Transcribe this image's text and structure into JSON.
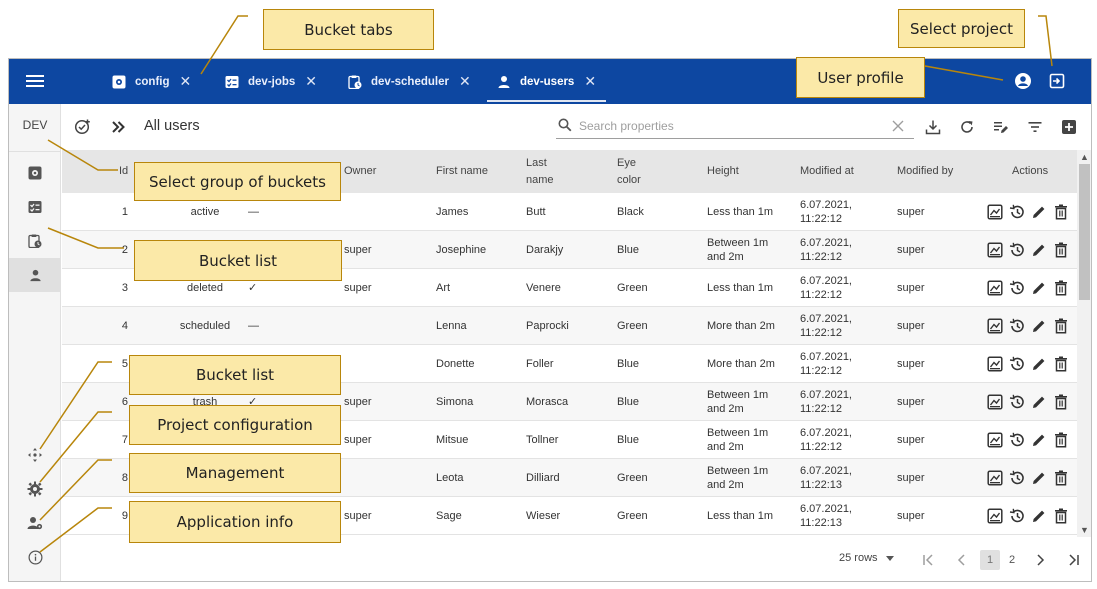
{
  "annotations": {
    "bucket_tabs": "Bucket tabs",
    "select_project": "Select project",
    "user_profile": "User profile",
    "select_group": "Select group of buckets",
    "bucket_list_1": "Bucket list",
    "bucket_list_2": "Bucket list",
    "project_configuration": "Project configuration",
    "management": "Management",
    "application_info": "Application info"
  },
  "colors": {
    "topbar": "#0d47a1",
    "callout_fill": "#fbe9a8",
    "callout_border": "#b8860b"
  },
  "topbar": {
    "menu_icon": "hamburger-icon",
    "tabs": [
      {
        "label": "config",
        "icon": "gear-box-icon"
      },
      {
        "label": "dev-jobs",
        "icon": "checklist-icon"
      },
      {
        "label": "dev-scheduler",
        "icon": "clipboard-clock-icon"
      },
      {
        "label": "dev-users",
        "icon": "user-icon",
        "active": true
      }
    ],
    "close_glyph": "✕"
  },
  "sidebar": {
    "project": "DEV"
  },
  "toolbar": {
    "title": "All users",
    "search_placeholder": "Search properties"
  },
  "table": {
    "headers": {
      "id": "Id",
      "owner": "Owner",
      "first_name": "First name",
      "last_name": "Last name",
      "eye_color": "Eye color",
      "height": "Height",
      "modified_at": "Modified at",
      "modified_by": "Modified by",
      "actions": "Actions"
    },
    "rows": [
      {
        "id": "1",
        "state": "active",
        "mark": "—",
        "owner": "",
        "first": "James",
        "last": "Butt",
        "eye": "Black",
        "height": "Less than 1m",
        "mod_date": "6.07.2021,",
        "mod_time": "11:22:12",
        "by": "super"
      },
      {
        "id": "2",
        "state": "",
        "mark": "",
        "owner": "super",
        "first": "Josephine",
        "last": "Darakjy",
        "eye": "Blue",
        "height": "Between 1m and 2m",
        "mod_date": "6.07.2021,",
        "mod_time": "11:22:12",
        "by": "super"
      },
      {
        "id": "3",
        "state": "deleted",
        "mark": "✓",
        "owner": "super",
        "first": "Art",
        "last": "Venere",
        "eye": "Green",
        "height": "Less than 1m",
        "mod_date": "6.07.2021,",
        "mod_time": "11:22:12",
        "by": "super"
      },
      {
        "id": "4",
        "state": "scheduled",
        "mark": "—",
        "owner": "",
        "first": "Lenna",
        "last": "Paprocki",
        "eye": "Green",
        "height": "More than 2m",
        "mod_date": "6.07.2021,",
        "mod_time": "11:22:12",
        "by": "super"
      },
      {
        "id": "5",
        "state": "",
        "mark": "",
        "owner": "",
        "first": "Donette",
        "last": "Foller",
        "eye": "Blue",
        "height": "More than 2m",
        "mod_date": "6.07.2021,",
        "mod_time": "11:22:12",
        "by": "super"
      },
      {
        "id": "6",
        "state": "trash",
        "mark": "✓",
        "owner": "super",
        "first": "Simona",
        "last": "Morasca",
        "eye": "Blue",
        "height": "Between 1m and 2m",
        "mod_date": "6.07.2021,",
        "mod_time": "11:22:12",
        "by": "super"
      },
      {
        "id": "7",
        "state": "",
        "mark": "",
        "owner": "super",
        "first": "Mitsue",
        "last": "Tollner",
        "eye": "Blue",
        "height": "Between 1m and 2m",
        "mod_date": "6.07.2021,",
        "mod_time": "11:22:12",
        "by": "super"
      },
      {
        "id": "8",
        "state": "",
        "mark": "",
        "owner": "",
        "first": "Leota",
        "last": "Dilliard",
        "eye": "Green",
        "height": "Between 1m and 2m",
        "mod_date": "6.07.2021,",
        "mod_time": "11:22:13",
        "by": "super"
      },
      {
        "id": "9",
        "state": "",
        "mark": "",
        "owner": "super",
        "first": "Sage",
        "last": "Wieser",
        "eye": "Green",
        "height": "Less than 1m",
        "mod_date": "6.07.2021,",
        "mod_time": "11:22:13",
        "by": "super"
      }
    ]
  },
  "footer": {
    "rows_per_page": "25 rows",
    "pages": [
      "1",
      "2"
    ],
    "current_page": "1"
  }
}
